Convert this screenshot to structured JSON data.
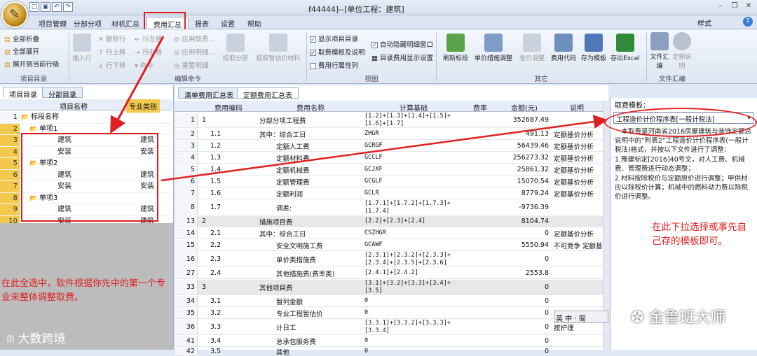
{
  "window": {
    "title": "f­­­­­­­­­­­­­­­­­­­­­­­­­­­­­­­­­­­­­­­­­44444]--[单位工程：建筑]",
    "style_label": "样式"
  },
  "menu": [
    "项目管理",
    "分部分项",
    "材机汇总",
    "费用汇总",
    "报表",
    "设置",
    "帮助"
  ],
  "ribbon": {
    "g1": {
      "buttons": [
        "全部折叠",
        "全部展开",
        "展开到当前行级"
      ],
      "label": "项目目录"
    },
    "g2": {
      "small": [
        "删除行",
        "行上移",
        "行下移",
        "行左移",
        "行右移",
        "命令",
        "应用取费...",
        "应用明细...",
        "重置明细",
        "插入行"
      ],
      "big": [
        "提取分部",
        "提取暂估价材料"
      ],
      "label": "编辑命令"
    },
    "g3": {
      "checks": [
        "显示项目目录",
        "取费模板及说明",
        "费用行属性列",
        "自动隐藏明细窗口",
        "目录费用显示设置"
      ],
      "label": "视图"
    },
    "g4": {
      "big": [
        "刷新标段",
        "单价措施调整",
        "省价调整",
        "费用代码",
        "存为模板",
        "存出Excel"
      ],
      "label": "其它"
    },
    "g5": {
      "big": [
        "文件汇编",
        "定额说明"
      ],
      "label": "文件汇编"
    }
  },
  "left": {
    "tabs": [
      "项目目录",
      "分部目录"
    ],
    "headers": [
      "项目名称",
      "专业类别"
    ],
    "rows": [
      {
        "n": "1",
        "name": "标段名称",
        "cat": "",
        "lvl": 0,
        "hl": false
      },
      {
        "n": "2",
        "name": "单项1",
        "cat": "",
        "lvl": 1,
        "hl": true
      },
      {
        "n": "3",
        "name": "建筑",
        "cat": "建筑",
        "lvl": 2,
        "hl": true
      },
      {
        "n": "4",
        "name": "安装",
        "cat": "安装",
        "lvl": 2,
        "hl": true
      },
      {
        "n": "5",
        "name": "单项2",
        "cat": "",
        "lvl": 1,
        "hl": true
      },
      {
        "n": "6",
        "name": "建筑",
        "cat": "建筑",
        "lvl": 2,
        "hl": true
      },
      {
        "n": "7",
        "name": "安装",
        "cat": "安装",
        "lvl": 2,
        "hl": true
      },
      {
        "n": "8",
        "name": "单项3",
        "cat": "",
        "lvl": 1,
        "hl": true
      },
      {
        "n": "9",
        "name": "建筑",
        "cat": "建筑",
        "lvl": 2,
        "hl": true
      },
      {
        "n": "10",
        "name": "安装",
        "cat": "建筑",
        "lvl": 2,
        "hl": true
      }
    ],
    "annotation": "在此全选中，软件根据你先中的第一个专业来整体调整取费。",
    "watermark": "大数跨境"
  },
  "main": {
    "tabs": [
      "清单费用汇总表",
      "定额费用汇总表"
    ],
    "headers": [
      "费用编码",
      "费用名称",
      "计算基础",
      "费率",
      "金额(元)",
      "说明"
    ],
    "rows": [
      {
        "i": "1",
        "code": "1",
        "name": "分部分项工程费",
        "base": "[1.2]+[1.3]+[1.4]+[1.5]+[1.6]+[1.7]",
        "rate": "",
        "amt": "352687.49",
        "note": "",
        "sec": false,
        "h": 22
      },
      {
        "i": "2",
        "code": "1.1",
        "name": "其中：综合工日",
        "base": "ZHGR",
        "rate": "",
        "amt": "491.13",
        "note": "定额基价分析",
        "sec": false,
        "h": 16
      },
      {
        "i": "3",
        "code": "1.2",
        "name": "定额人工费",
        "base": "GCRGF",
        "rate": "",
        "amt": "56439.46",
        "note": "定额基价分析",
        "sec": false,
        "h": 16
      },
      {
        "i": "4",
        "code": "1.3",
        "name": "定额材料费",
        "base": "GCCLF",
        "rate": "",
        "amt": "256273.32",
        "note": "定额基价分析",
        "sec": false,
        "h": 16
      },
      {
        "i": "5",
        "code": "1.4",
        "name": "定额机械费",
        "base": "GCJXF",
        "rate": "",
        "amt": "25861.32",
        "note": "定额基价分析",
        "sec": false,
        "h": 16
      },
      {
        "i": "6",
        "code": "1.5",
        "name": "定额管理费",
        "base": "GCGLF",
        "rate": "",
        "amt": "15070.54",
        "note": "定额基价分析",
        "sec": false,
        "h": 16
      },
      {
        "i": "7",
        "code": "1.6",
        "name": "定额利润",
        "base": "GCLR",
        "rate": "",
        "amt": "8779.24",
        "note": "定额基价分析",
        "sec": false,
        "h": 16
      },
      {
        "i": "8",
        "code": "1.7",
        "name": "调差:",
        "base": "[1.7.1]+[1.7.2]+[1.7.3]+[1.7.4]",
        "rate": "",
        "amt": "-9736.39",
        "note": "",
        "sec": false,
        "h": 22
      },
      {
        "i": "13",
        "code": "2",
        "name": "措施项目费",
        "base": "[2.2]+[2.3]+[2.4]",
        "rate": "",
        "amt": "8104.74",
        "note": "",
        "sec": true,
        "h": 16
      },
      {
        "i": "14",
        "code": "2.1",
        "name": "其中：综合工日",
        "base": "CSZHGR",
        "rate": "",
        "amt": "0",
        "note": "定额基价分析",
        "sec": false,
        "h": 16
      },
      {
        "i": "15",
        "code": "2.2",
        "name": "安全文明施工费",
        "base": "GCAWF",
        "rate": "",
        "amt": "5550.94",
        "note": "不可竞争 定额基",
        "sec": false,
        "h": 16
      },
      {
        "i": "16",
        "code": "2.3",
        "name": "单价类措施费",
        "base": "[2.3.1]+[2.3.2]+[2.3.3]+[2.3.4]+[2.3.5]+[2.3.6]",
        "rate": "",
        "amt": "0",
        "note": "",
        "sec": false,
        "h": 22
      },
      {
        "i": "27",
        "code": "2.4",
        "name": "其他措施费(费率类)",
        "base": "[2.4.1]+[2.4.2]",
        "rate": "",
        "amt": "2553.8",
        "note": "",
        "sec": false,
        "h": 16
      },
      {
        "i": "33",
        "code": "3",
        "name": "其他项目费",
        "base": "[3.1]+[3.2]+[3.3]+[3.4]+[3.5]",
        "rate": "",
        "amt": "0",
        "note": "",
        "sec": true,
        "h": 22
      },
      {
        "i": "34",
        "code": "3.1",
        "name": "暂列金额",
        "base": "0",
        "rate": "",
        "amt": "0",
        "note": "",
        "sec": false,
        "h": 16
      },
      {
        "i": "35",
        "code": "3.2",
        "name": "专业工程暂估价",
        "base": "0",
        "rate": "",
        "amt": "0",
        "note": "",
        "sec": false,
        "h": 16
      },
      {
        "i": "36",
        "code": "3.3",
        "name": "计日工",
        "base": "[3.3.1]+[3.3.2]+[3.3.3]+[3.3.4]",
        "rate": "",
        "amt": "0",
        "note": "按护理",
        "sec": false,
        "h": 22
      },
      {
        "i": "41",
        "code": "3.4",
        "name": "总承包服务费",
        "base": "0",
        "rate": "",
        "amt": "0",
        "note": "",
        "sec": false,
        "h": 16
      },
      {
        "i": "42",
        "code": "3.5",
        "name": "其他",
        "base": "0",
        "rate": "",
        "amt": "0",
        "note": "",
        "sec": false,
        "h": 12
      }
    ]
  },
  "right": {
    "label": "取费模板：",
    "select": "工程造价计价程序表[一般计税法]",
    "desc": "　本取费是河南省2016房屋建筑与装饰定额总说明中的“附表2”工程造价计价程序表(一般计税法)格式，并按以下文件进行了调整：\n1.豫建标定[2016]40号文，对人工费、机械费、管理费进行动态调整；\n2.材料按除税价与定额原价进行调整；甲供材应以除税价计算；机械中的燃料动力费以除税价进行调整。",
    "annotation": "在此下拉选择或事先自己存的模板即可。",
    "watermark": "金鲁班大师",
    "ime": "英 中 · 简"
  },
  "colors": {
    "annotation": "#e02020",
    "highlight": "#f2c94c"
  }
}
